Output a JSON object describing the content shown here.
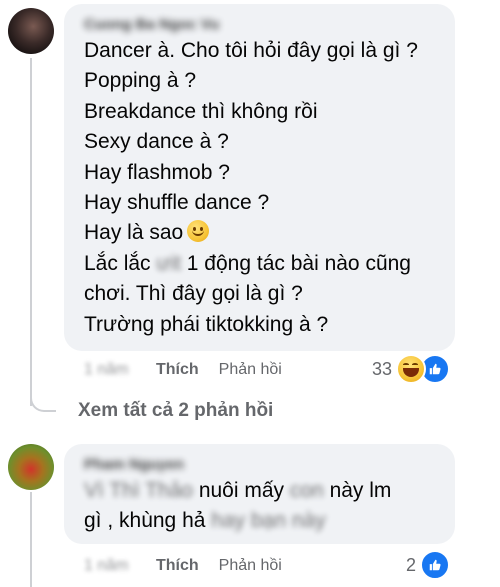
{
  "comments": [
    {
      "author": "Cuong Ba Ngoc Vu",
      "lines": [
        "Dancer à. Cho tôi hỏi đây gọi là gì ?",
        "Popping à ?",
        "Breakdance thì không rồi",
        "Sexy dance à ?",
        "Hay flashmob ?",
        "Hay shuffle dance ?",
        "Hay là sao",
        "chơi. Thì đây gọi là gì ?",
        "Trường phái tiktokking à ?"
      ],
      "line8_prefix": "Lắc lắc",
      "line8_blur": "ưit",
      "line8_suffix": "1 động tác bài nào cũng",
      "time": "1 năm",
      "like_label": "Thích",
      "reply_label": "Phản hồi",
      "reaction_count": "33",
      "reaction_icons": [
        "haha-icon",
        "like-icon"
      ]
    },
    {
      "author": "Pham Nguyen",
      "line1_blur1": "Vì Thì Thảo",
      "line1_text": "nuôi mấy",
      "line1_blur2": "con",
      "line1_text2": "này lm",
      "line2_text": "gì , khùng hả",
      "line2_blur": "hay bạn này",
      "time": "1 năm",
      "like_label": "Thích",
      "reply_label": "Phản hồi",
      "reaction_count": "2",
      "reaction_icons": [
        "like-icon"
      ]
    }
  ],
  "view_replies": "Xem tất cả 2 phản hồi",
  "colors": {
    "bubble": "#f0f2f5",
    "secondary_text": "#65676b",
    "like_blue": "#1877f2",
    "thread_line": "#ced0d4"
  }
}
